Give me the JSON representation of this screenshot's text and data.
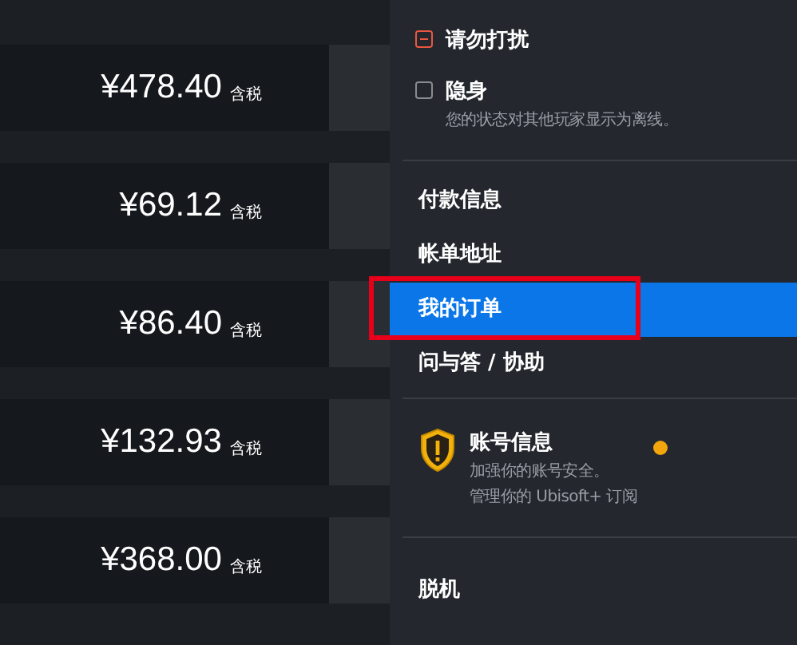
{
  "orders": [
    {
      "price": "¥478.40",
      "tax": "含税"
    },
    {
      "price": "¥69.12",
      "tax": "含税"
    },
    {
      "price": "¥86.40",
      "tax": "含税"
    },
    {
      "price": "¥132.93",
      "tax": "含税"
    },
    {
      "price": "¥368.00",
      "tax": "含税"
    }
  ],
  "menu": {
    "statuses": [
      {
        "kind": "dnd",
        "label": "请勿打扰",
        "checked": true
      },
      {
        "kind": "invisible",
        "label": "隐身",
        "checked": false,
        "description": "您的状态对其他玩家显示为离线。"
      }
    ],
    "links": [
      {
        "label": "付款信息",
        "selected": false
      },
      {
        "label": "帐单地址",
        "selected": false
      },
      {
        "label": "我的订单",
        "selected": true
      },
      {
        "label": "问与答 / 协助",
        "selected": false
      }
    ],
    "account": {
      "title": "账号信息",
      "lines": [
        "加强你的账号安全。",
        "管理你的 Ubisoft+ 订阅"
      ],
      "alert": true
    },
    "bottom": [
      {
        "label": "脱机"
      }
    ]
  }
}
